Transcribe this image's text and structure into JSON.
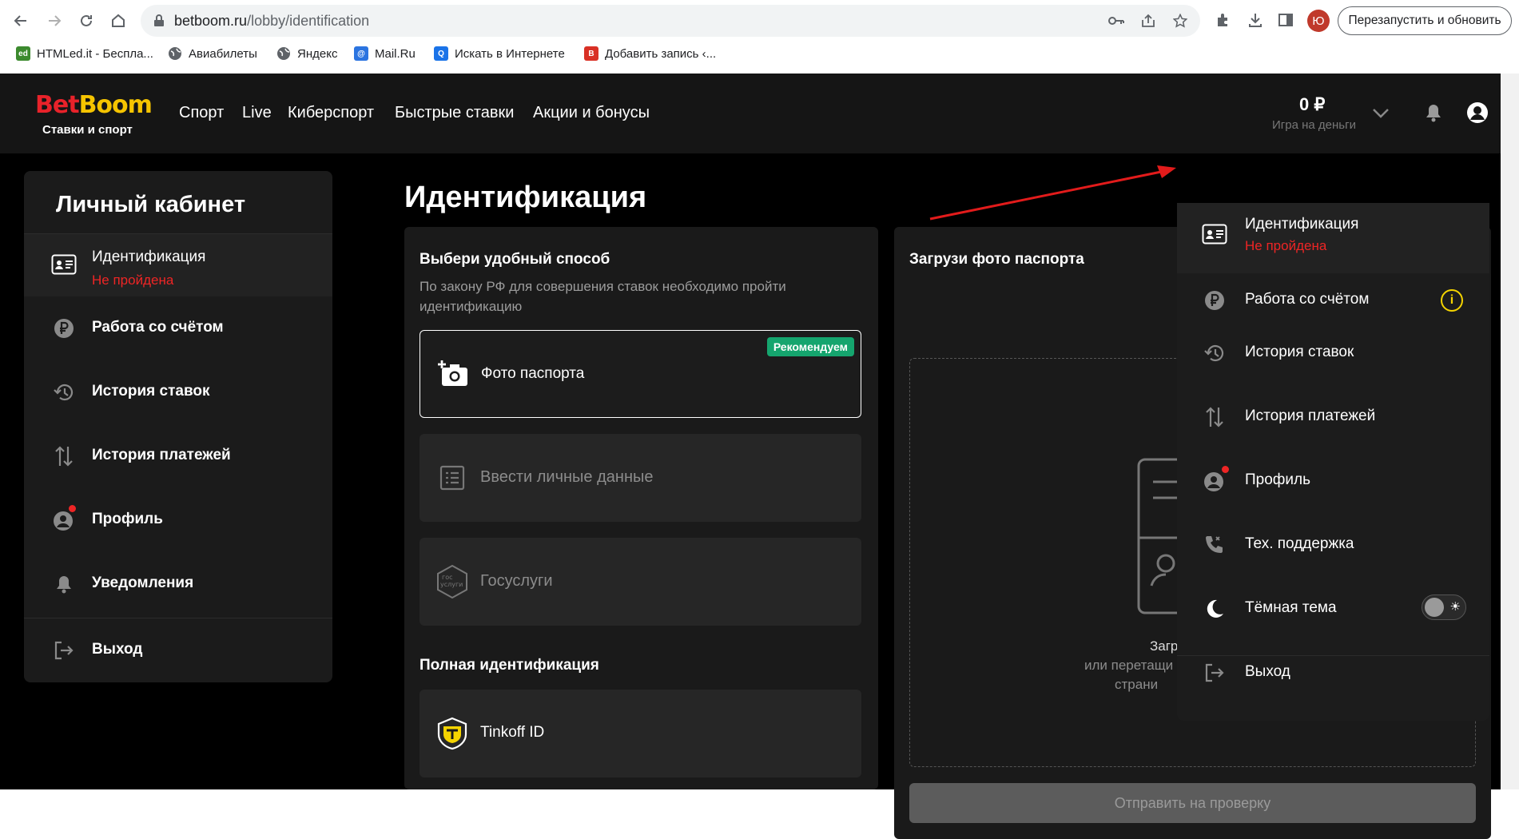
{
  "browser": {
    "url_host": "betboom.ru",
    "url_path": "/lobby/identification",
    "avatar_letter": "Ю",
    "relaunch_label": "Перезапустить и обновить",
    "bookmarks": [
      {
        "label": "HTMLed.it - Беспла...",
        "icon": "htmled-icon"
      },
      {
        "label": "Авиабилеты",
        "icon": "globe-icon"
      },
      {
        "label": "Яндекс",
        "icon": "globe-icon"
      },
      {
        "label": "Mail.Ru",
        "icon": "mailru-icon"
      },
      {
        "label": "Искать в Интернете",
        "icon": "search-icon"
      },
      {
        "label": "Добавить запись ‹...",
        "icon": "blogger-icon"
      }
    ]
  },
  "header": {
    "logo_bet": "Bet",
    "logo_boom": "Boom",
    "logo_sub": "Ставки и спорт",
    "nav": [
      "Спорт",
      "Live",
      "Киберспорт",
      "Быстрые ставки",
      "Акции и бонусы"
    ],
    "balance": "0 ₽",
    "balance_sub": "Игра на деньги"
  },
  "sidebar": {
    "title": "Личный кабинет",
    "items": [
      {
        "label": "Идентификация",
        "status": "Не пройдена",
        "icon": "id-card-icon"
      },
      {
        "label": "Работа со счётом",
        "icon": "ruble-icon"
      },
      {
        "label": "История ставок",
        "icon": "history-icon"
      },
      {
        "label": "История платежей",
        "icon": "arrows-updown-icon"
      },
      {
        "label": "Профиль",
        "icon": "profile-icon"
      },
      {
        "label": "Уведомления",
        "icon": "bell-icon"
      },
      {
        "label": "Выход",
        "icon": "logout-icon"
      }
    ]
  },
  "main": {
    "title": "Идентификация",
    "methods": {
      "title": "Выбери удобный способ",
      "desc_line1": "По закону РФ для совершения ставок необходимо пройти",
      "desc_line2": "идентификацию",
      "options": [
        {
          "label": "Фото паспорта",
          "badge": "Рекомендуем",
          "icon": "camera-add-icon"
        },
        {
          "label": "Ввести личные данные",
          "icon": "form-list-icon"
        },
        {
          "label": "Госуслуги",
          "icon": "gosuslugi-icon"
        }
      ],
      "full_title": "Полная идентификация",
      "tinkoff": {
        "label": "Tinkoff ID",
        "icon": "tinkoff-icon"
      }
    },
    "upload": {
      "title": "Загрузи фото паспорта",
      "text_1": "Загр",
      "text_2": "или перетащи",
      "text_3": "страни",
      "submit_label": "Отправить на проверку"
    }
  },
  "dropdown": {
    "items": [
      {
        "label": "Идентификация",
        "status": "Не пройдена",
        "icon": "id-card-icon"
      },
      {
        "label": "Работа со счётом",
        "icon": "ruble-icon",
        "info": "i"
      },
      {
        "label": "История ставок",
        "icon": "history-icon"
      },
      {
        "label": "История платежей",
        "icon": "arrows-updown-icon"
      },
      {
        "label": "Профиль",
        "icon": "profile-icon"
      },
      {
        "label": "Тех. поддержка",
        "icon": "phone-icon"
      },
      {
        "label": "Тёмная тема",
        "icon": "moon-icon"
      },
      {
        "label": "Выход",
        "icon": "logout-icon"
      }
    ]
  },
  "colors": {
    "accent_red": "#ee2525",
    "logo_yellow": "#f5c400",
    "badge_green": "#15a56e",
    "info_yellow": "#f5d400"
  }
}
